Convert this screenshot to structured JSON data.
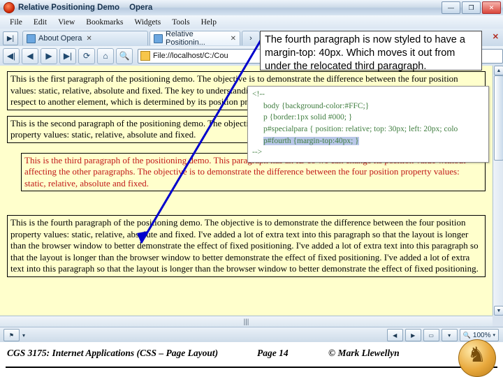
{
  "window": {
    "title": "Relative Positioning Demo",
    "app": "Opera",
    "buttons": {
      "minimize": "—",
      "maximize": "❐",
      "close": "✕"
    }
  },
  "menu": [
    "File",
    "Edit",
    "View",
    "Bookmarks",
    "Widgets",
    "Tools",
    "Help"
  ],
  "tabs": {
    "panel_toggle": "▶|",
    "items": [
      {
        "label": "About Opera",
        "active": false,
        "close": "✕"
      },
      {
        "label": "Relative Positionin...",
        "active": true,
        "close": "✕"
      }
    ],
    "overflow": "›",
    "close_all": "✕"
  },
  "toolbar": {
    "back": "◀",
    "forward": "▶",
    "rewind": "◀|",
    "fastforward": "▶|",
    "reload": "⟳",
    "home": "⌂",
    "search_page": "🔍",
    "address_value": "File://localhost/C:/Cou",
    "go": "▶"
  },
  "page": {
    "paragraphs": [
      "This is the first paragraph of the positioning demo. The objective is to demonstrate the difference between the four position values: static, relative, absolute and fixed. The key to understanding relative positioning is that the element is positioned with respect to another element, which is determined by its position property.",
      "This is the second paragraph of the positioning demo. The objective is to demonstrate the difference between the four position property values: static, relative, absolute and fixed.",
      "This is the third paragraph of the positioning demo. This paragraph has an ID so we can change its position value without affecting the other paragraphs. The objective is to demonstrate the difference between the four position property values: static, relative, absolute and fixed.",
      "This is the fourth paragraph of the positioning demo. The objective is to demonstrate the difference between the four position property values: static, relative, absolute and fixed. I've added a lot of extra text into this paragraph so that the layout is longer than the browser window to better demonstrate the effect of fixed positioning. I've added a lot of extra text into this paragraph so that the layout is longer than the browser window to better demonstrate the effect of fixed positioning. I've added a lot of extra text into this paragraph so that the layout is longer than the browser window to better demonstrate the effect of fixed positioning."
    ]
  },
  "code_callout": {
    "lines": [
      {
        "text": "<!--",
        "indent": false,
        "highlight": false
      },
      {
        "text": "body {background-color:#FFC;}",
        "indent": true,
        "highlight": false
      },
      {
        "text": "p {border:1px solid #000; }",
        "indent": true,
        "highlight": false
      },
      {
        "text": "p#specialpara { position: relative; top: 30px; left: 20px; colo",
        "indent": true,
        "highlight": false
      },
      {
        "text": "p#fourth  {margin-top:40px; }",
        "indent": true,
        "highlight": true
      },
      {
        "text": "-->",
        "indent": false,
        "highlight": false
      }
    ]
  },
  "annotation": {
    "text": "The fourth paragraph is now styled to have a margin-top: 40px.  Which moves it out from under the relocated third paragraph."
  },
  "statusbar": {
    "left_menu": "⚑",
    "left_caret": "▾",
    "hscroll_grip": "|||",
    "prev": "◀",
    "next": "▶",
    "panel": "▭",
    "panel_caret": "▾",
    "zoom_icon": "🔍",
    "zoom_value": "100%",
    "zoom_caret": "▾"
  },
  "footer": {
    "course": "CGS 3175: Internet Applications (CSS – Page Layout)",
    "page": "Page 14",
    "copyright": "© Mark Llewellyn"
  },
  "colors": {
    "page_background": "#FFFFCC",
    "third_paragraph_text": "#C01818",
    "code_text": "#3F7D3F",
    "arrow": "#0000CC",
    "highlight": "#B9C7E8"
  }
}
